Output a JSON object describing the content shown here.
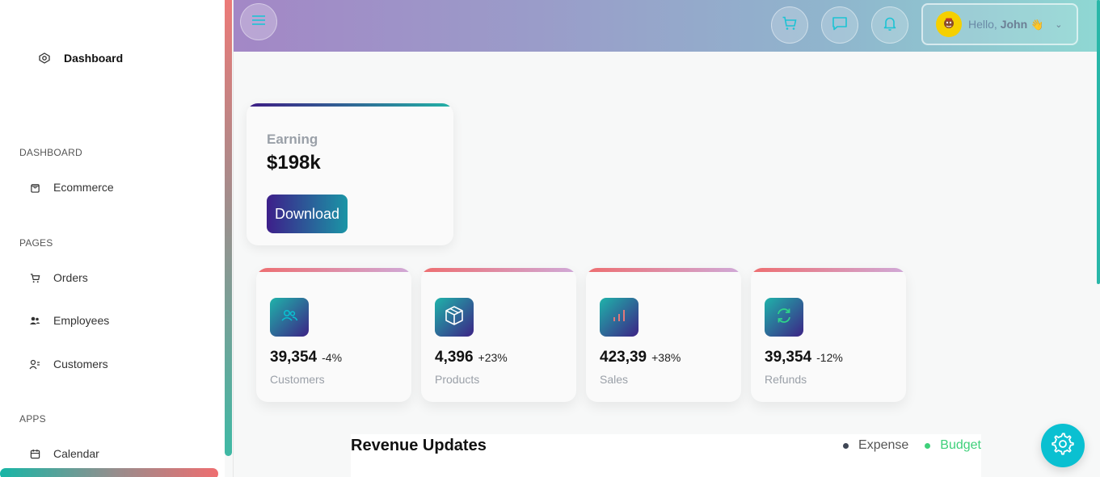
{
  "sidebar": {
    "brand": {
      "label": "Dashboard",
      "icon": "dashboard-icon"
    },
    "sections": [
      {
        "title": "DASHBOARD",
        "items": [
          {
            "label": "Ecommerce",
            "icon": "shopping-bag-icon"
          }
        ]
      },
      {
        "title": "PAGES",
        "items": [
          {
            "label": "Orders",
            "icon": "cart-icon"
          },
          {
            "label": "Employees",
            "icon": "employees-icon"
          },
          {
            "label": "Customers",
            "icon": "customers-icon"
          }
        ]
      },
      {
        "title": "APPS",
        "items": [
          {
            "label": "Calendar",
            "icon": "calendar-icon"
          }
        ]
      }
    ]
  },
  "topbar": {
    "menu_icon": "menu-icon",
    "buttons": [
      "cart-icon",
      "chat-icon",
      "bell-icon"
    ],
    "profile": {
      "greeting": "Hello,",
      "name": "John",
      "wave": "👋"
    }
  },
  "earning": {
    "label": "Earning",
    "value": "$198k",
    "button": "Download"
  },
  "stats": [
    {
      "value": "39,354",
      "change": "-4%",
      "label": "Customers",
      "icon": "users-icon",
      "icon_color": "#0ac0d1"
    },
    {
      "value": "4,396",
      "change": "+23%",
      "label": "Products",
      "icon": "box-icon",
      "icon_color": "#ffffff"
    },
    {
      "value": "423,39",
      "change": "+38%",
      "label": "Sales",
      "icon": "bar-chart-icon",
      "icon_color": "#e0787a"
    },
    {
      "value": "39,354",
      "change": "-12%",
      "label": "Refunds",
      "icon": "refresh-icon",
      "icon_color": "#2fd38a"
    }
  ],
  "revenue": {
    "title": "Revenue Updates",
    "legend": [
      {
        "label": "Expense",
        "color": "#3f4655"
      },
      {
        "label": "Budget",
        "color": "#3ed07a"
      }
    ]
  },
  "colors": {
    "accent": "#0ac0d1",
    "brand_purple": "#3d1f8a"
  }
}
